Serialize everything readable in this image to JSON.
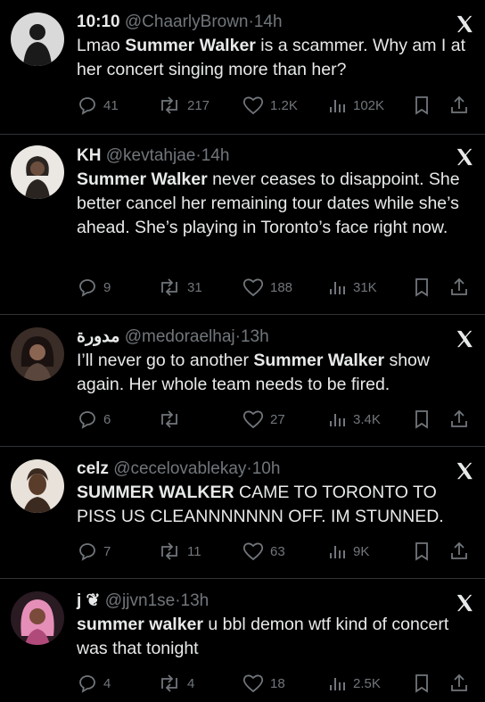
{
  "tweets": [
    {
      "name": "10:10",
      "handle": "@ChaarlyBrown",
      "time": "14h",
      "text_parts": [
        {
          "t": "Lmao ",
          "b": false
        },
        {
          "t": "Summer Walker",
          "b": true
        },
        {
          "t": " is a scammer. Why am I at her concert singing more than her?",
          "b": false
        }
      ],
      "replies": "41",
      "retweets": "217",
      "likes": "1.2K",
      "views": "102K",
      "avatar_bg": "#d9d9d9",
      "avatar_fg": "#1a1a1a"
    },
    {
      "name": "KH",
      "handle": "@kevtahjae",
      "time": "14h",
      "text_parts": [
        {
          "t": "Summer Walker",
          "b": true
        },
        {
          "t": " never ceases to disappoint. She better cancel her remaining tour dates while she’s ahead. She’s playing in Toronto’s face right now.",
          "b": false
        }
      ],
      "replies": "9",
      "retweets": "31",
      "likes": "188",
      "views": "31K",
      "avatar_bg": "#ebe8e4",
      "avatar_fg": "#2a2420"
    },
    {
      "name": "مدورة",
      "handle": "@medoraelhaj",
      "time": "13h",
      "text_parts": [
        {
          "t": "I’ll never go to another ",
          "b": false
        },
        {
          "t": "Summer Walker",
          "b": true
        },
        {
          "t": " show again. Her whole team needs to be fired.",
          "b": false
        }
      ],
      "replies": "6",
      "retweets": "",
      "likes": "27",
      "views": "3.4K",
      "avatar_bg": "#3a2c26",
      "avatar_fg": "#1a1210"
    },
    {
      "name": "celz",
      "handle": "@cecelovablekay",
      "time": "10h",
      "text_parts": [
        {
          "t": "SUMMER WALKER",
          "b": true
        },
        {
          "t": " CAME TO TORONTO TO PISS US CLEANNNNNNN OFF. IM STUNNED.",
          "b": false
        }
      ],
      "replies": "7",
      "retweets": "11",
      "likes": "63",
      "views": "9K",
      "avatar_bg": "#e8e2da",
      "avatar_fg": "#3a2a20"
    },
    {
      "name": "j ❦",
      "handle": "@jjvn1se",
      "time": "13h",
      "text_parts": [
        {
          "t": "summer walker",
          "b": true
        },
        {
          "t": " u bbl demon wtf kind of concert was that tonight",
          "b": false
        }
      ],
      "replies": "4",
      "retweets": "4",
      "likes": "18",
      "views": "2.5K",
      "avatar_bg": "#2a1a22",
      "avatar_fg": "#e58fb8"
    }
  ],
  "icons": {
    "reply": "reply-icon",
    "retweet": "retweet-icon",
    "like": "heart-icon",
    "views": "views-icon",
    "bookmark": "bookmark-icon",
    "share": "share-icon",
    "logo": "x-logo-icon"
  },
  "colors": {
    "background": "#000000",
    "text": "#e7e9ea",
    "muted": "#71767b",
    "divider": "#2f3336"
  }
}
